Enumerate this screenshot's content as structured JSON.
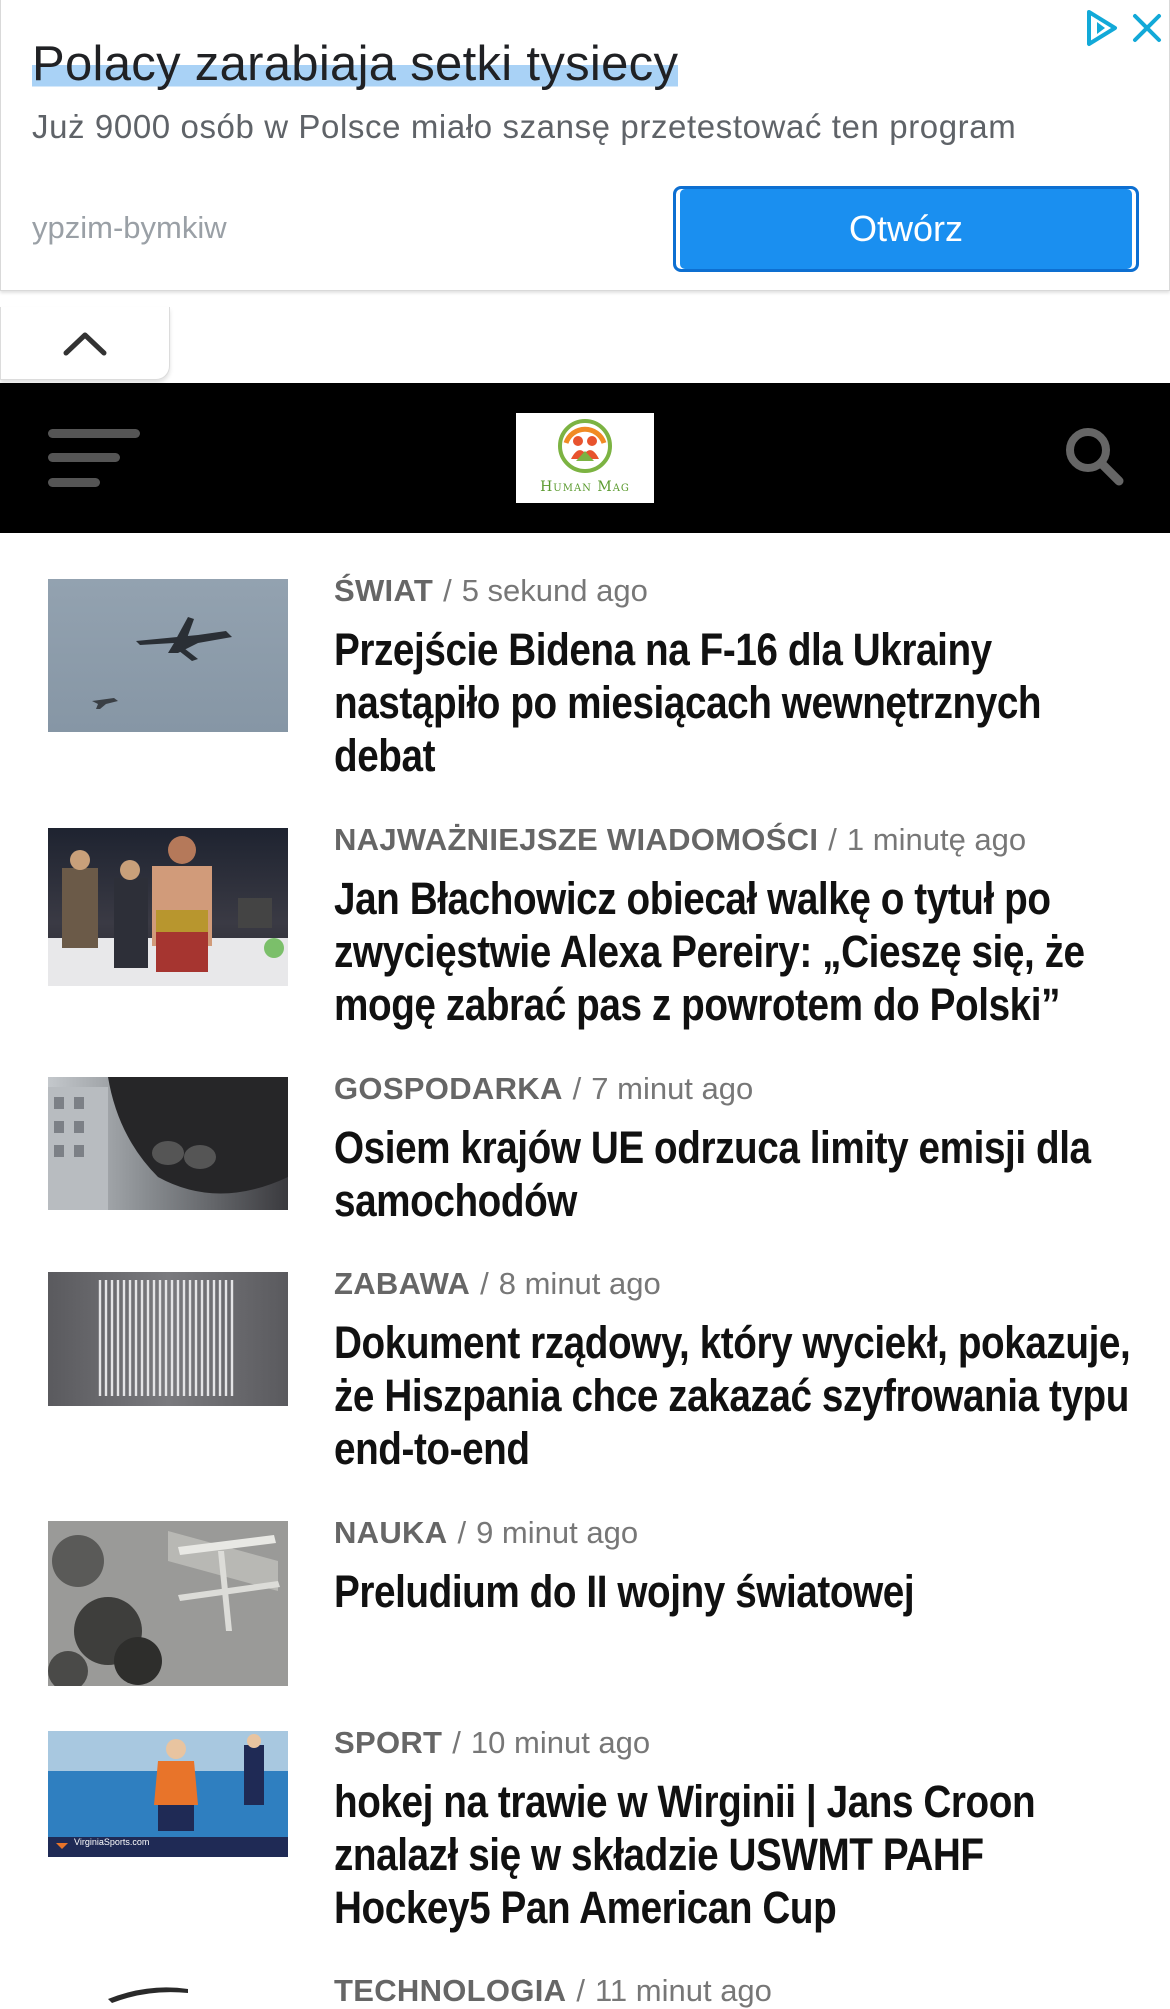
{
  "ad": {
    "title": "Polacy zarabiaja setki tysiecy",
    "description": "Już 9000 osób w Polsce miało szansę przetestować ten program",
    "domain": "ypzim-bymkiw",
    "button_label": "Otwórz"
  },
  "header": {
    "logo_text": "Human Mag"
  },
  "articles": [
    {
      "category": "ŚWIAT",
      "time": "5 sekund ago",
      "title": "Przejście Bidena na F-16 dla Ukrainy nastąpiło po miesiącach wewnętrznych debat"
    },
    {
      "category": "NAJWAŻNIEJSZE WIADOMOŚCI",
      "time": "1 minutę ago",
      "title": "Jan Błachowicz obiecał walkę o tytuł po zwycięstwie Alexa Pereiry: „Cieszę się, że mogę zabrać pas z powrotem do Polski”"
    },
    {
      "category": "GOSPODARKA",
      "time": "7 minut ago",
      "title": "Osiem krajów UE odrzuca limity emisji dla samochodów"
    },
    {
      "category": "ZABAWA",
      "time": "8 minut ago",
      "title": "Dokument rządowy, który wyciekł, pokazuje, że Hiszpania chce zakazać szyfrowania typu end-to-end"
    },
    {
      "category": "NAUKA",
      "time": "9 minut ago",
      "title": "Preludium do II wojny światowej"
    },
    {
      "category": "SPORT",
      "time": "10 minut ago",
      "title": "hokej na trawie w Wirginii | Jans Croon znalazł się w składzie USWMT PAHF Hockey5 Pan American Cup",
      "thumb_caption": "VirginiaSports.com"
    },
    {
      "category": "TECHNOLOGIA",
      "time": "11 minut ago",
      "title": ""
    }
  ]
}
